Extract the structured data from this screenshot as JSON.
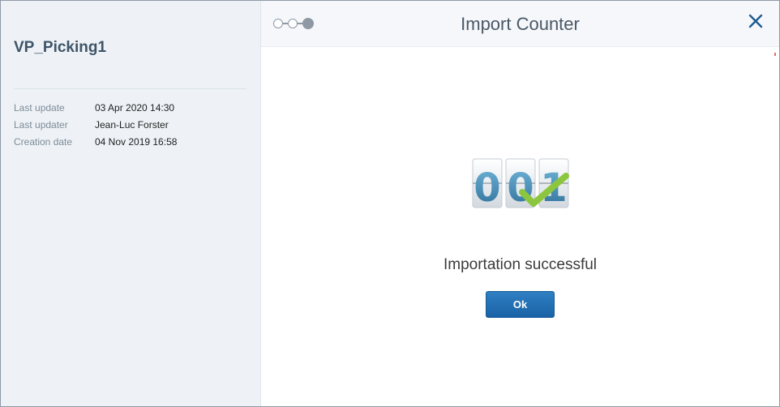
{
  "record": {
    "title": "VP_Picking1",
    "fields": [
      {
        "label": "Last update",
        "value": "03 Apr 2020 14:30"
      },
      {
        "label": "Last updater",
        "value": "Jean-Luc Forster"
      },
      {
        "label": "Creation date",
        "value": "04 Nov 2019 16:58"
      }
    ]
  },
  "dialog": {
    "title": "Import Counter",
    "steps_total": 3,
    "current_step": 3,
    "counter_digits": [
      "0",
      "0",
      "1"
    ],
    "message": "Importation successful",
    "ok_label": "Ok",
    "close_icon": "close-icon",
    "success_icon": "checkmark-icon"
  },
  "colors": {
    "accent": "#1f6cb0",
    "title_text": "#3e5468",
    "checkmark": "#8cc63f",
    "digit": "#4a90b8"
  }
}
